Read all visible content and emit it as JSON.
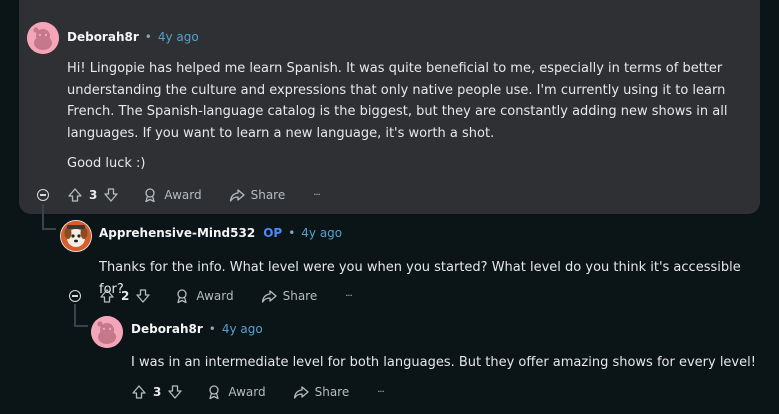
{
  "comments": [
    {
      "username": "Deborah8r",
      "op": "",
      "age": "4y ago",
      "paragraphs": [
        "Hi! Lingopie has helped me learn Spanish. It was quite beneficial to me, especially in terms of better understanding the culture and expressions that only native people use. I'm currently using it to learn French. The Spanish-language catalog is the biggest, but they are constantly adding new shows in all languages. If you want to learn a new language, it's worth a shot.",
        "Good luck :)"
      ],
      "votes": "3",
      "award_label": "Award",
      "share_label": "Share",
      "more_label": "···"
    },
    {
      "username": "Apprehensive-Mind532",
      "op": "OP",
      "age": "4y ago",
      "paragraphs": [
        "Thanks for the info. What level were you when you started? What level do you think it's accessible for?"
      ],
      "votes": "2",
      "award_label": "Award",
      "share_label": "Share",
      "more_label": "···"
    },
    {
      "username": "Deborah8r",
      "op": "",
      "age": "4y ago",
      "paragraphs": [
        "I was in an intermediate level for both languages. But they offer amazing shows for every level!"
      ],
      "votes": "3",
      "award_label": "Award",
      "share_label": "Share",
      "more_label": "···"
    }
  ],
  "meta_separator": "•",
  "icons": {
    "avatar_pink": "snoo-avatar-icon",
    "avatar_dog": "dog-avatar-icon",
    "upvote": "upvote-arrow-icon",
    "downvote": "downvote-arrow-icon",
    "award": "award-icon",
    "share": "share-arrow-icon",
    "collapse": "collapse-thread-icon"
  },
  "colors": {
    "background": "#0b1416",
    "highlight": "#2f3033",
    "timestamp": "#4fa3d1",
    "op_badge": "#4c8bf5"
  }
}
